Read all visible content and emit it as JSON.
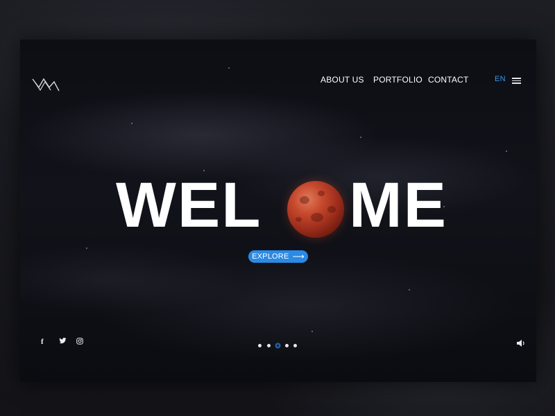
{
  "nav": {
    "items": [
      {
        "label": "ABOUT US"
      },
      {
        "label": "PORTFOLIO"
      },
      {
        "label": "CONTACT"
      }
    ],
    "language": "EN"
  },
  "hero": {
    "headline_left": "WEL",
    "headline_right": "ME",
    "moon_replaces_letter": "C O",
    "cta_label": "EXPLORE",
    "cta_arrow": "⟶"
  },
  "social": {
    "facebook": "f",
    "twitter": "twitter-icon",
    "instagram": "instagram-icon"
  },
  "slider": {
    "total": 5,
    "active_index": 2
  },
  "colors": {
    "accent": "#2a8ae4",
    "language": "#3a95e8",
    "moon": "#c6492e",
    "background": "#0d0e14"
  },
  "icons": {
    "logo": "wave-logo-icon",
    "menu": "hamburger-menu-icon",
    "sound": "speaker-icon"
  }
}
